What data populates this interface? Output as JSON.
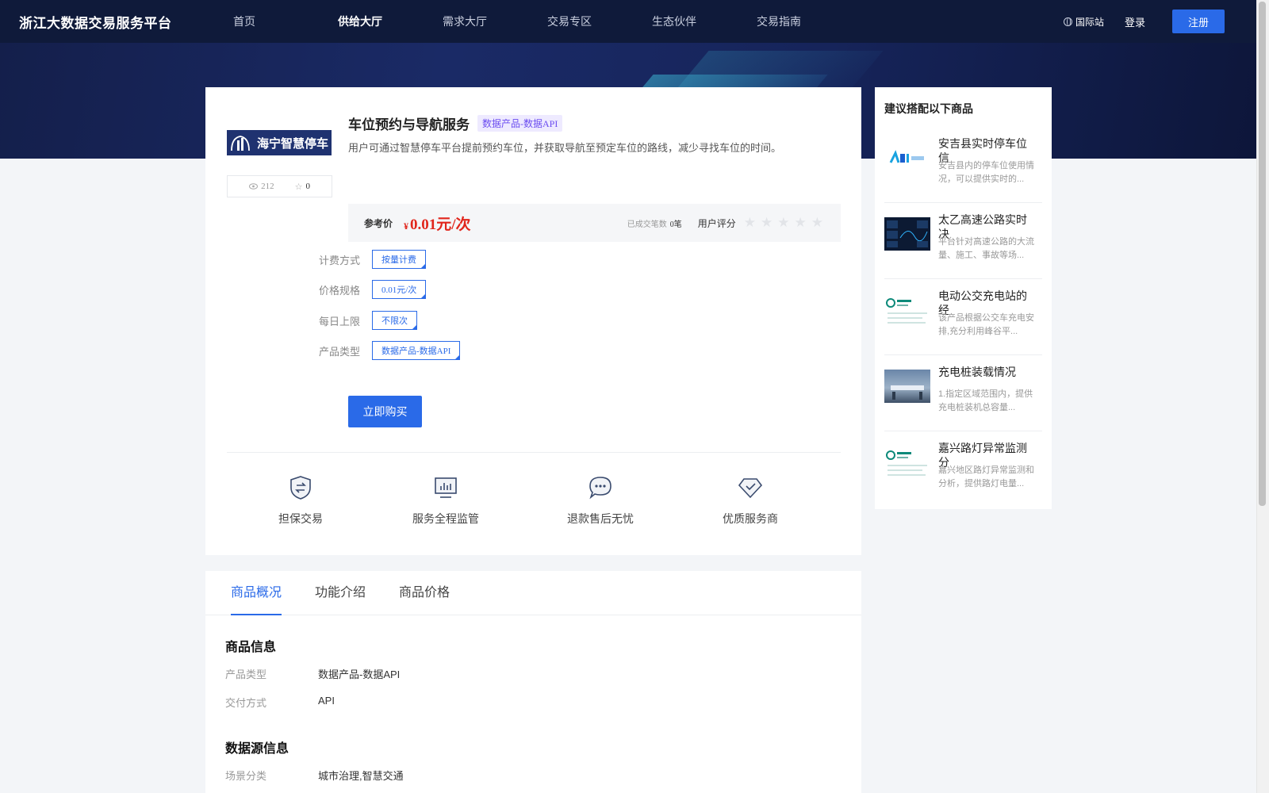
{
  "header": {
    "logo": "浙江大数据交易服务平台",
    "nav": [
      "首页",
      "供给大厅",
      "需求大厅",
      "交易专区",
      "生态伙伴",
      "交易指南"
    ],
    "active_nav_index": 1,
    "intl": "国际站",
    "login": "登录",
    "register": "注册"
  },
  "product": {
    "logo_text": "海宁智慧停车",
    "views": "212",
    "favorites": "0",
    "title": "车位预约与导航服务",
    "tag": "数据产品-数据API",
    "description": "用户可通过智慧停车平台提前预约车位，并获取导航至预定车位的路线，减少寻找车位的时间。",
    "price_label": "参考价",
    "currency": "¥",
    "price": "0.01元/次",
    "deal_label": "已成交笔数",
    "deal_count": "0笔",
    "rating_label": "用户评分",
    "rating": 0,
    "rating_max": 5,
    "specs": [
      {
        "label": "计费方式",
        "value": "按量计费"
      },
      {
        "label": "价格规格",
        "value": "0.01元/次"
      },
      {
        "label": "每日上限",
        "value": "不限次"
      },
      {
        "label": "产品类型",
        "value": "数据产品-数据API"
      }
    ],
    "buy_button": "立即购买",
    "features": [
      {
        "label": "担保交易",
        "icon": "shield-exchange-icon"
      },
      {
        "label": "服务全程监管",
        "icon": "monitor-chart-icon"
      },
      {
        "label": "退款售后无忧",
        "icon": "chat-bubble-icon"
      },
      {
        "label": "优质服务商",
        "icon": "diamond-check-icon"
      }
    ]
  },
  "sidebar": {
    "title": "建议搭配以下商品",
    "items": [
      {
        "name": "安吉县实时停车位信",
        "desc": "安吉县内的停车位使用情况，可以提供实时的..."
      },
      {
        "name": "太乙高速公路实时决",
        "desc": "平台针对高速公路的大流量、施工、事故等场..."
      },
      {
        "name": "电动公交充电站的经",
        "desc": "该产品根据公交车充电安排,充分利用峰谷平..."
      },
      {
        "name": "充电桩装载情况",
        "desc": "1.指定区域范围内，提供充电桩装机总容量..."
      },
      {
        "name": "嘉兴路灯异常监测分",
        "desc": "嘉兴地区路灯异常监测和分析，提供路灯电量..."
      }
    ]
  },
  "tabs": {
    "items": [
      "商品概况",
      "功能介绍",
      "商品价格"
    ],
    "active_index": 0
  },
  "overview": {
    "section1_title": "商品信息",
    "section1_rows": [
      {
        "k": "产品类型",
        "v": "数据产品-数据API"
      },
      {
        "k": "交付方式",
        "v": "API"
      }
    ],
    "section2_title": "数据源信息",
    "section2_rows": [
      {
        "k": "场景分类",
        "v": "城市治理,智慧交通"
      }
    ]
  },
  "colors": {
    "primary": "#2a6ae8",
    "price": "#e1261c",
    "header_bg": "#0f1a3a"
  }
}
